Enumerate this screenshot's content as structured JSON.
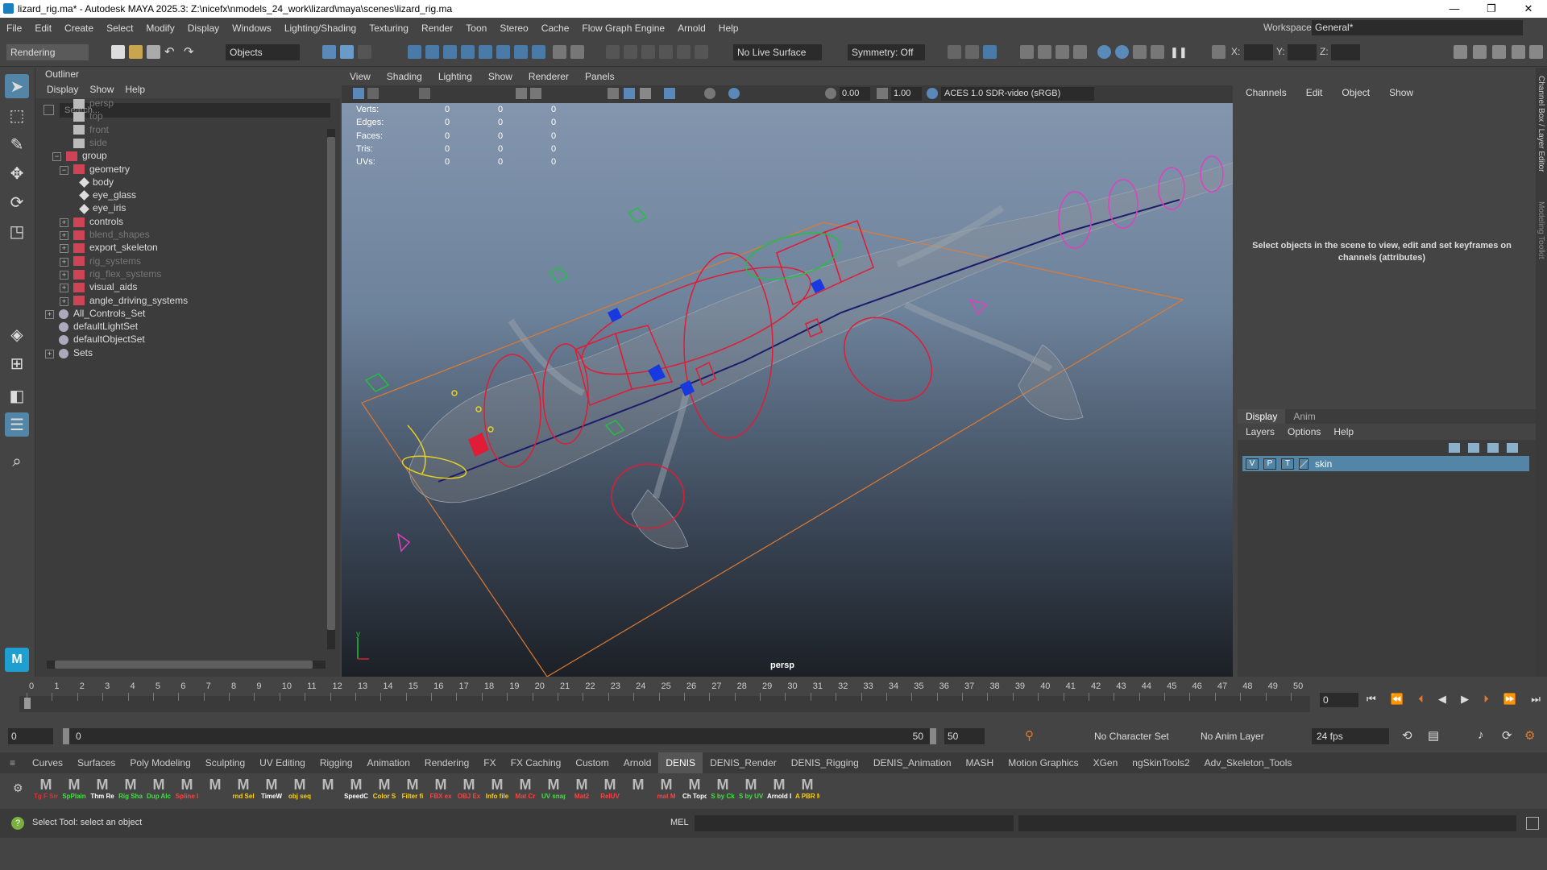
{
  "window": {
    "title": "lizard_rig.ma* - Autodesk MAYA 2025.3: Z:\\nicefx\\nmodels_24_work\\lizard\\maya\\scenes\\lizard_rig.ma",
    "controls": [
      "—",
      "❐",
      "✕"
    ]
  },
  "menubar": [
    "File",
    "Edit",
    "Create",
    "Select",
    "Modify",
    "Display",
    "Windows",
    "Lighting/Shading",
    "Texturing",
    "Render",
    "Toon",
    "Stereo",
    "Cache",
    "Flow Graph Engine",
    "Arnold",
    "Help"
  ],
  "workspace": {
    "label": "Workspace:",
    "value": "General*"
  },
  "toolbar": {
    "menuset": "Rendering",
    "objects": "Objects",
    "live_surface": "No Live Surface",
    "symmetry": "Symmetry: Off",
    "x": "X:",
    "y": "Y:",
    "z": "Z:"
  },
  "outliner": {
    "title": "Outliner",
    "menu": [
      "Display",
      "Show",
      "Help"
    ],
    "search_placeholder": "Search...",
    "items": [
      {
        "label": "persp",
        "indent": 1,
        "dim": true,
        "icon": "camera"
      },
      {
        "label": "top",
        "indent": 1,
        "dim": true,
        "icon": "camera"
      },
      {
        "label": "front",
        "indent": 1,
        "dim": true,
        "icon": "camera"
      },
      {
        "label": "side",
        "indent": 1,
        "dim": true,
        "icon": "camera"
      },
      {
        "label": "group",
        "indent": 0,
        "exp": "−",
        "icon": "group"
      },
      {
        "label": "geometry",
        "indent": 1,
        "exp": "−",
        "icon": "group"
      },
      {
        "label": "body",
        "indent": 2,
        "icon": "mesh"
      },
      {
        "label": "eye_glass",
        "indent": 2,
        "icon": "mesh"
      },
      {
        "label": "eye_iris",
        "indent": 2,
        "icon": "mesh"
      },
      {
        "label": "controls",
        "indent": 1,
        "exp": "+",
        "icon": "group"
      },
      {
        "label": "blend_shapes",
        "indent": 1,
        "exp": "+",
        "dim": true,
        "icon": "group"
      },
      {
        "label": "export_skeleton",
        "indent": 1,
        "exp": "+",
        "icon": "group"
      },
      {
        "label": "rig_systems",
        "indent": 1,
        "exp": "+",
        "dim": true,
        "icon": "group"
      },
      {
        "label": "rig_flex_systems",
        "indent": 1,
        "exp": "+",
        "dim": true,
        "icon": "group"
      },
      {
        "label": "visual_aids",
        "indent": 1,
        "exp": "+",
        "icon": "group"
      },
      {
        "label": "angle_driving_systems",
        "indent": 1,
        "exp": "+",
        "icon": "group"
      },
      {
        "label": "All_Controls_Set",
        "indent": -1,
        "exp": "+",
        "icon": "set"
      },
      {
        "label": "defaultLightSet",
        "indent": -1,
        "icon": "set"
      },
      {
        "label": "defaultObjectSet",
        "indent": -1,
        "icon": "set"
      },
      {
        "label": "Sets",
        "indent": -1,
        "exp": "+",
        "icon": "set"
      }
    ]
  },
  "viewport": {
    "menu": [
      "View",
      "Shading",
      "Lighting",
      "Show",
      "Renderer",
      "Panels"
    ],
    "camera": "persp",
    "colorspace": "ACES 1.0 SDR-video (sRGB)",
    "near": "0.00",
    "far": "1.00",
    "hud": [
      {
        "label": "Verts:",
        "v": [
          "0",
          "0",
          "0"
        ]
      },
      {
        "label": "Edges:",
        "v": [
          "0",
          "0",
          "0"
        ]
      },
      {
        "label": "Faces:",
        "v": [
          "0",
          "0",
          "0"
        ]
      },
      {
        "label": "Tris:",
        "v": [
          "0",
          "0",
          "0"
        ]
      },
      {
        "label": "UVs:",
        "v": [
          "0",
          "0",
          "0"
        ]
      }
    ]
  },
  "channelbox": {
    "menu": [
      "Channels",
      "Edit",
      "Object",
      "Show"
    ],
    "message": "Select objects in the scene to view, edit and set keyframes on channels (attributes)",
    "tabs": [
      "Display",
      "Anim"
    ],
    "layer_menu": [
      "Layers",
      "Options",
      "Help"
    ],
    "layer": {
      "v": "V",
      "p": "P",
      "t": "T",
      "name": "skin"
    },
    "side_labels": [
      "Channel Box / Layer Editor",
      "Modeling Toolkit"
    ]
  },
  "timeline": {
    "ticks": [
      "0",
      "1",
      "2",
      "3",
      "4",
      "5",
      "6",
      "7",
      "8",
      "9",
      "10",
      "11",
      "12",
      "13",
      "14",
      "15",
      "16",
      "17",
      "18",
      "19",
      "20",
      "21",
      "22",
      "23",
      "24",
      "25",
      "26",
      "27",
      "28",
      "29",
      "30",
      "31",
      "32",
      "33",
      "34",
      "35",
      "36",
      "37",
      "38",
      "39",
      "40",
      "41",
      "42",
      "43",
      "44",
      "45",
      "46",
      "47",
      "48",
      "49",
      "50"
    ],
    "current": "0",
    "frame_field": "0"
  },
  "range": {
    "start": "0",
    "inner_start": "0",
    "inner_end": "50",
    "end": "50",
    "character_set": "No Character Set",
    "anim_layer": "No Anim Layer",
    "fps": "24 fps"
  },
  "shelf_tabs": [
    "Curves",
    "Surfaces",
    "Poly Modeling",
    "Sculpting",
    "UV Editing",
    "Rigging",
    "Animation",
    "Rendering",
    "FX",
    "FX Caching",
    "Custom",
    "Arnold",
    "DENIS",
    "DENIS_Render",
    "DENIS_Rigging",
    "DENIS_Animation",
    "MASH",
    "Motion Graphics",
    "XGen",
    "ngSkinTools2",
    "Adv_Skeleton_Tools"
  ],
  "shelf_active": "DENIS",
  "shelf_icons": [
    {
      "label": "Tg F Sm",
      "color": "#e03030"
    },
    {
      "label": "SpPlain",
      "color": "#40e040"
    },
    {
      "label": "Thm Re",
      "color": "#ffffff"
    },
    {
      "label": "Rig Sha",
      "color": "#40e040"
    },
    {
      "label": "Dup Alc",
      "color": "#40e040"
    },
    {
      "label": "Spline I",
      "color": "#ff4040"
    },
    {
      "label": "",
      "color": "#ffffff"
    },
    {
      "label": "rnd Sel",
      "color": "#ffd000"
    },
    {
      "label": "TimeW",
      "color": "#ffffff"
    },
    {
      "label": "obj seq",
      "color": "#ffd000"
    },
    {
      "label": "",
      "color": "#ffffff"
    },
    {
      "label": "SpeedC",
      "color": "#ffffff"
    },
    {
      "label": "Color S",
      "color": "#ffd000"
    },
    {
      "label": "Filter fi",
      "color": "#ffd000"
    },
    {
      "label": "FBX ex",
      "color": "#ff4040"
    },
    {
      "label": "OBJ Ex",
      "color": "#ff4040"
    },
    {
      "label": "Info file",
      "color": "#ffd000"
    },
    {
      "label": "Mat Cr",
      "color": "#ff4040"
    },
    {
      "label": "UV snap",
      "color": "#40e040"
    },
    {
      "label": "Mat2",
      "color": "#ff4040"
    },
    {
      "label": "RelUV",
      "color": "#ff4040"
    },
    {
      "label": "",
      "color": "#ffffff"
    },
    {
      "label": "mat M",
      "color": "#ff4040"
    },
    {
      "label": "Ch Topo",
      "color": "#ffffff"
    },
    {
      "label": "S by Ck",
      "color": "#40e040"
    },
    {
      "label": "S by UV",
      "color": "#40e040"
    },
    {
      "label": "Arnold Displacem",
      "color": "#ffffff"
    },
    {
      "label": "A PBR MAT",
      "color": "#ffd000"
    }
  ],
  "helpline": "Select Tool: select an object",
  "command": {
    "lang": "MEL"
  },
  "colors": {
    "accent": "#5285a6",
    "layer_bg": "#5285a6"
  }
}
